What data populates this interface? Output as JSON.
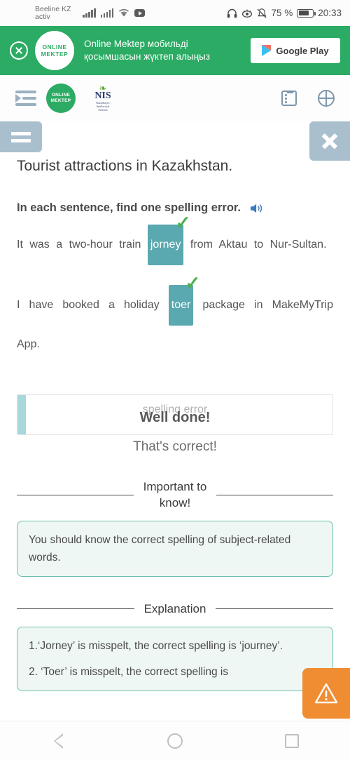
{
  "status_bar": {
    "carrier_line1": "Beeline KZ",
    "carrier_line2": "activ",
    "battery_text": "75 %",
    "time": "20:33",
    "icons": [
      "signal-bars-icon",
      "signal-bars-icon",
      "wifi-icon",
      "youtube-icon",
      "headphones-icon",
      "eye-comfort-icon",
      "mute-icon",
      "battery-icon"
    ]
  },
  "promo_banner": {
    "close_label": "close-banner",
    "logo_line1": "ONLINE",
    "logo_line2": "MEKTEP",
    "text": "Online Mektep мобильді қосымшасын жүктеп алыңыз",
    "store_button": "Google Play",
    "background_color": "#2bab63"
  },
  "navbar": {
    "menu_icon": "indent-menu-icon",
    "om_logo_line1": "ONLINE",
    "om_logo_line2": "MEKTEP",
    "nis_logo_title": "NIS",
    "nis_logo_sub1": "Nazarbayev",
    "nis_logo_sub2": "Intellectual",
    "nis_logo_sub3": "Schools",
    "list_icon": "list-icon",
    "globe_icon": "globe-icon"
  },
  "toolbar": {
    "menu_button": "menu-button",
    "close_button": "close-button"
  },
  "lesson": {
    "title": "Tourist attractions in Kazakhstan.",
    "prompt": "In each sentence, find one spelling error.",
    "audio_icon": "speaker-icon",
    "sentences": [
      {
        "before": "It was a two-hour train",
        "answer": "jorney",
        "after": "from Aktau to Nur-Sultan.",
        "correct": true
      },
      {
        "before": "I have booked a holiday",
        "answer": "toer",
        "after": "package in MakeMyTrip App.",
        "correct": true
      }
    ],
    "highlight_color": "#5aa8b0",
    "check_color": "#4caf50"
  },
  "result": {
    "placeholder": "spelling error",
    "headline": "Well done!",
    "subtext": "That's correct!",
    "accent_color": "#a8d8dc"
  },
  "important": {
    "heading_line1": "Important to",
    "heading_line2": "know!",
    "body": "You should know the correct spelling of subject-related words."
  },
  "explanation": {
    "heading": "Explanation",
    "items": [
      "1.‘Jorney’ is misspelt, the correct spelling is ‘journey’.",
      "2. ‘Toer’ is misspelt, the correct spelling is"
    ]
  },
  "report_button": {
    "icon": "warning-triangle-icon",
    "color": "#f08c32"
  },
  "android_nav": {
    "back": "back-button",
    "home": "home-button",
    "recents": "recents-button"
  }
}
